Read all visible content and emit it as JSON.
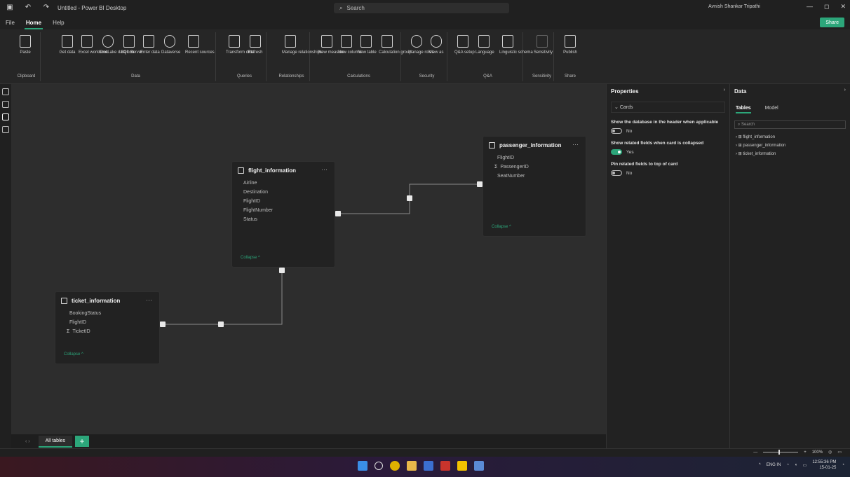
{
  "titlebar": {
    "app_title": "Untitled - Power BI Desktop",
    "search_placeholder": "Search",
    "user_name": "Avnish Shankar Tripathi",
    "minimize": "—",
    "maximize": "◻",
    "close": "✕"
  },
  "menu": {
    "file": "File",
    "home": "Home",
    "help": "Help",
    "share": "Share"
  },
  "ribbon": {
    "groups": [
      {
        "name": "Clipboard",
        "buttons": [
          "Paste"
        ]
      },
      {
        "name": "Data",
        "buttons": [
          "Get data",
          "Excel workbook",
          "OneLake data hub",
          "SQL Server",
          "Enter data",
          "Dataverse",
          "Recent sources"
        ]
      },
      {
        "name": "Queries",
        "buttons": [
          "Transform data",
          "Refresh"
        ]
      },
      {
        "name": "Relationships",
        "buttons": [
          "Manage relationships"
        ]
      },
      {
        "name": "Calculations",
        "buttons": [
          "New measure",
          "New column",
          "New table",
          "Calculation group"
        ]
      },
      {
        "name": "Security",
        "buttons": [
          "Manage roles",
          "View as"
        ]
      },
      {
        "name": "Q&A",
        "buttons": [
          "Q&A setup",
          "Language",
          "Linguistic schema"
        ]
      },
      {
        "name": "Sensitivity",
        "buttons": [
          "Sensitivity"
        ]
      },
      {
        "name": "Share",
        "buttons": [
          "Publish"
        ]
      }
    ]
  },
  "model": {
    "tables": [
      {
        "name": "flight_information",
        "fields": [
          {
            "sig": "",
            "name": "Airline"
          },
          {
            "sig": "",
            "name": "Destination"
          },
          {
            "sig": "",
            "name": "FlightID"
          },
          {
            "sig": "",
            "name": "FlightNumber"
          },
          {
            "sig": "",
            "name": "Status"
          }
        ],
        "collapse": "Collapse ^"
      },
      {
        "name": "passenger_information",
        "fields": [
          {
            "sig": "",
            "name": "FlightID"
          },
          {
            "sig": "Σ",
            "name": "PassengerID"
          },
          {
            "sig": "",
            "name": "SeatNumber"
          }
        ],
        "collapse": "Collapse ^"
      },
      {
        "name": "ticket_information",
        "fields": [
          {
            "sig": "",
            "name": "BookingStatus"
          },
          {
            "sig": "",
            "name": "FlightID"
          },
          {
            "sig": "Σ",
            "name": "TicketID"
          }
        ],
        "collapse": "Collapse ^"
      }
    ],
    "relations": [
      {
        "from": "flight_information",
        "to": "passenger_information",
        "from_card": "1",
        "to_card": "*"
      },
      {
        "from": "flight_information",
        "to": "ticket_information",
        "from_card": "1",
        "to_card": "*"
      }
    ]
  },
  "layout_tabs": {
    "all_tables": "All tables",
    "add": "+"
  },
  "properties": {
    "title": "Properties",
    "section": "Cards",
    "settings": [
      {
        "label": "Show the database in the header when applicable",
        "value": "No",
        "on": false
      },
      {
        "label": "Show related fields when card is collapsed",
        "value": "Yes",
        "on": true
      },
      {
        "label": "Pin related fields to top of card",
        "value": "No",
        "on": false
      }
    ]
  },
  "data_pane": {
    "title": "Data",
    "tabs": [
      "Tables",
      "Model"
    ],
    "search_placeholder": "Search",
    "tables": [
      "flight_information",
      "passenger_information",
      "ticket_information"
    ]
  },
  "status": {
    "zoom": "100%"
  },
  "taskbar": {
    "lang": "ENG IN",
    "time": "12:55:36 PM",
    "date": "15-01-25"
  },
  "colors": {
    "accent": "#2ca67a",
    "canvas": "#2d2d2d",
    "card": "#222222"
  }
}
